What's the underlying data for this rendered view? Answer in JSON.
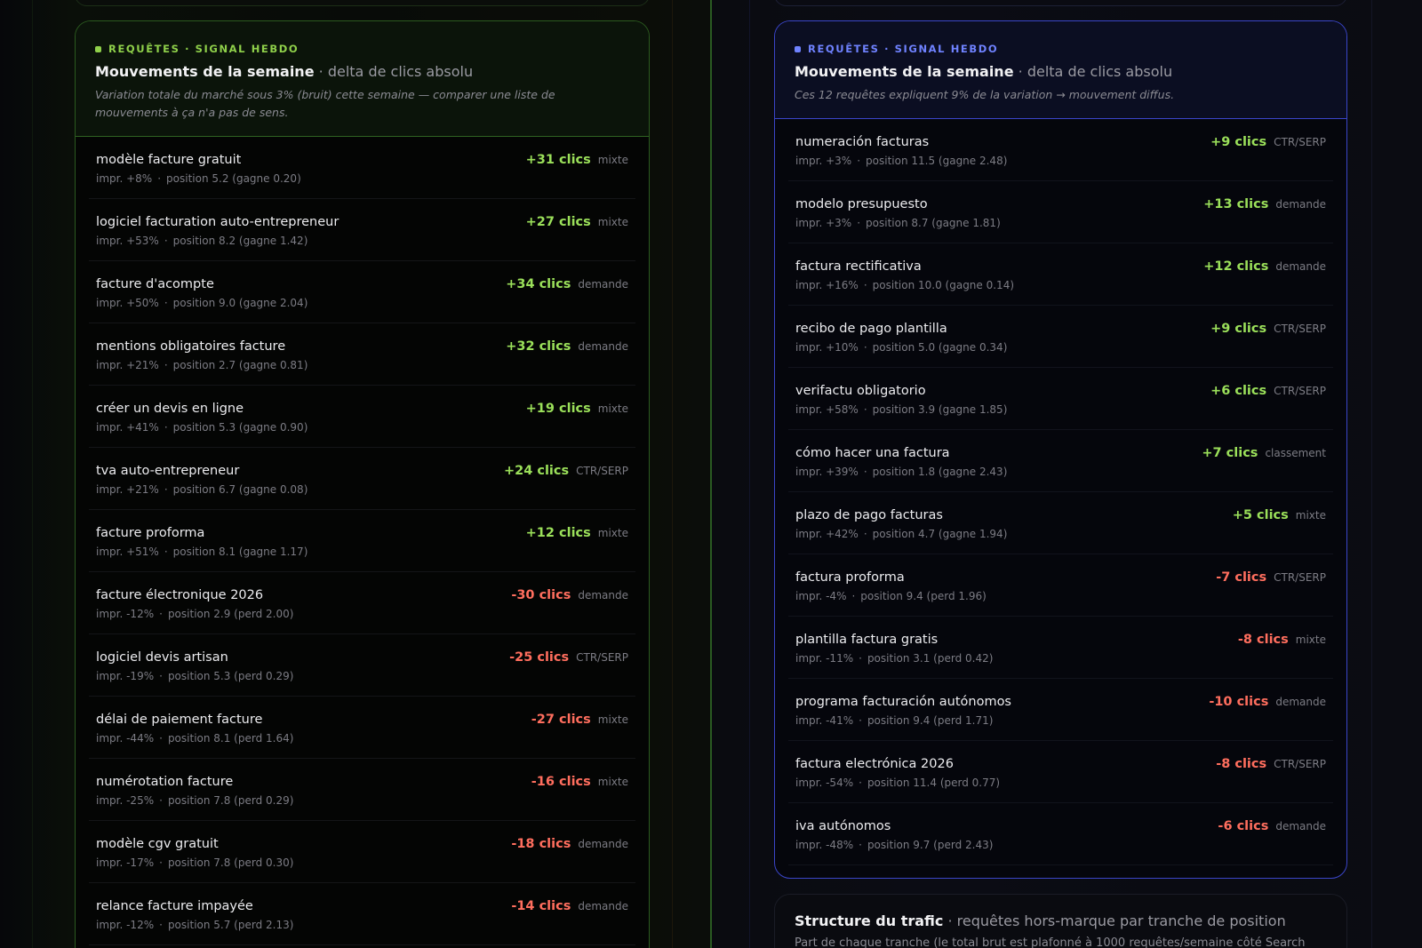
{
  "left_panel": {
    "eyebrow": "REQUÊTES · SIGNAL HEBDO",
    "title": "Mouvements de la semaine",
    "subtitle": "delta de clics absolu",
    "note": "Variation totale du marché sous 3% (bruit) cette semaine — comparer une liste de mouvements à ça n'a pas de sens.",
    "accent": "#8fd04a",
    "rows": [
      {
        "query": "modèle facture gratuit",
        "impr": "impr. +8%",
        "position": "position 5.2 (gagne 0.20)",
        "delta": "+31 clics",
        "dir": "pos",
        "tag": "mixte"
      },
      {
        "query": "logiciel facturation auto-entrepreneur",
        "impr": "impr. +53%",
        "position": "position 8.2 (gagne 1.42)",
        "delta": "+27 clics",
        "dir": "pos",
        "tag": "mixte"
      },
      {
        "query": "facture d'acompte",
        "impr": "impr. +50%",
        "position": "position 9.0 (gagne 2.04)",
        "delta": "+34 clics",
        "dir": "pos",
        "tag": "demande"
      },
      {
        "query": "mentions obligatoires facture",
        "impr": "impr. +21%",
        "position": "position 2.7 (gagne 0.81)",
        "delta": "+32 clics",
        "dir": "pos",
        "tag": "demande"
      },
      {
        "query": "créer un devis en ligne",
        "impr": "impr. +41%",
        "position": "position 5.3 (gagne 0.90)",
        "delta": "+19 clics",
        "dir": "pos",
        "tag": "mixte"
      },
      {
        "query": "tva auto-entrepreneur",
        "impr": "impr. +21%",
        "position": "position 6.7 (gagne 0.08)",
        "delta": "+24 clics",
        "dir": "pos",
        "tag": "CTR/SERP"
      },
      {
        "query": "facture proforma",
        "impr": "impr. +51%",
        "position": "position 8.1 (gagne 1.17)",
        "delta": "+12 clics",
        "dir": "pos",
        "tag": "mixte"
      },
      {
        "query": "facture électronique 2026",
        "impr": "impr. -12%",
        "position": "position 2.9 (perd 2.00)",
        "delta": "-30 clics",
        "dir": "neg",
        "tag": "demande"
      },
      {
        "query": "logiciel devis artisan",
        "impr": "impr. -19%",
        "position": "position 5.3 (perd 0.29)",
        "delta": "-25 clics",
        "dir": "neg",
        "tag": "CTR/SERP"
      },
      {
        "query": "délai de paiement facture",
        "impr": "impr. -44%",
        "position": "position 8.1 (perd 1.64)",
        "delta": "-27 clics",
        "dir": "neg",
        "tag": "mixte"
      },
      {
        "query": "numérotation facture",
        "impr": "impr. -25%",
        "position": "position 7.8 (perd 0.29)",
        "delta": "-16 clics",
        "dir": "neg",
        "tag": "mixte"
      },
      {
        "query": "modèle cgv gratuit",
        "impr": "impr. -17%",
        "position": "position 7.8 (perd 0.30)",
        "delta": "-18 clics",
        "dir": "neg",
        "tag": "demande"
      },
      {
        "query": "relance facture impayée",
        "impr": "impr. -12%",
        "position": "position 5.7 (perd 2.13)",
        "delta": "-14 clics",
        "dir": "neg",
        "tag": "demande"
      }
    ]
  },
  "right_panel": {
    "eyebrow": "REQUÊTES · SIGNAL HEBDO",
    "title": "Mouvements de la semaine",
    "subtitle": "delta de clics absolu",
    "note": "Ces 12 requêtes expliquent 9% de la variation → mouvement diffus.",
    "accent": "#6f82ff",
    "rows": [
      {
        "query": "numeración facturas",
        "impr": "impr. +3%",
        "position": "position 11.5 (gagne 2.48)",
        "delta": "+9 clics",
        "dir": "pos",
        "tag": "CTR/SERP"
      },
      {
        "query": "modelo presupuesto",
        "impr": "impr. +3%",
        "position": "position 8.7 (gagne 1.81)",
        "delta": "+13 clics",
        "dir": "pos",
        "tag": "demande"
      },
      {
        "query": "factura rectificativa",
        "impr": "impr. +16%",
        "position": "position 10.0 (gagne 0.14)",
        "delta": "+12 clics",
        "dir": "pos",
        "tag": "demande"
      },
      {
        "query": "recibo de pago plantilla",
        "impr": "impr. +10%",
        "position": "position 5.0 (gagne 0.34)",
        "delta": "+9 clics",
        "dir": "pos",
        "tag": "CTR/SERP"
      },
      {
        "query": "verifactu obligatorio",
        "impr": "impr. +58%",
        "position": "position 3.9 (gagne 1.85)",
        "delta": "+6 clics",
        "dir": "pos",
        "tag": "CTR/SERP"
      },
      {
        "query": "cómo hacer una factura",
        "impr": "impr. +39%",
        "position": "position 1.8 (gagne 2.43)",
        "delta": "+7 clics",
        "dir": "pos",
        "tag": "classement"
      },
      {
        "query": "plazo de pago facturas",
        "impr": "impr. +42%",
        "position": "position 4.7 (gagne 1.94)",
        "delta": "+5 clics",
        "dir": "pos",
        "tag": "mixte"
      },
      {
        "query": "factura proforma",
        "impr": "impr. -4%",
        "position": "position 9.4 (perd 1.96)",
        "delta": "-7 clics",
        "dir": "neg",
        "tag": "CTR/SERP"
      },
      {
        "query": "plantilla factura gratis",
        "impr": "impr. -11%",
        "position": "position 3.1 (perd 0.42)",
        "delta": "-8 clics",
        "dir": "neg",
        "tag": "mixte"
      },
      {
        "query": "programa facturación autónomos",
        "impr": "impr. -41%",
        "position": "position 9.4 (perd 1.71)",
        "delta": "-10 clics",
        "dir": "neg",
        "tag": "demande"
      },
      {
        "query": "factura electrónica 2026",
        "impr": "impr. -54%",
        "position": "position 11.4 (perd 0.77)",
        "delta": "-8 clics",
        "dir": "neg",
        "tag": "CTR/SERP"
      },
      {
        "query": "iva autónomos",
        "impr": "impr. -48%",
        "position": "position 9.7 (perd 2.43)",
        "delta": "-6 clics",
        "dir": "neg",
        "tag": "demande"
      }
    ]
  },
  "structure_card": {
    "title": "Structure du trafic",
    "subtitle": "requêtes hors-marque par tranche de position",
    "note": "Part de chaque tranche (le total brut est plafonné à 1000 requêtes/semaine côté Search"
  },
  "separator": "·",
  "bullet": "·",
  "colors": {
    "positive": "#9be05a",
    "negative": "#ff6e5e",
    "left_border": "#2b5a1f",
    "right_border": "#3a45c8"
  }
}
